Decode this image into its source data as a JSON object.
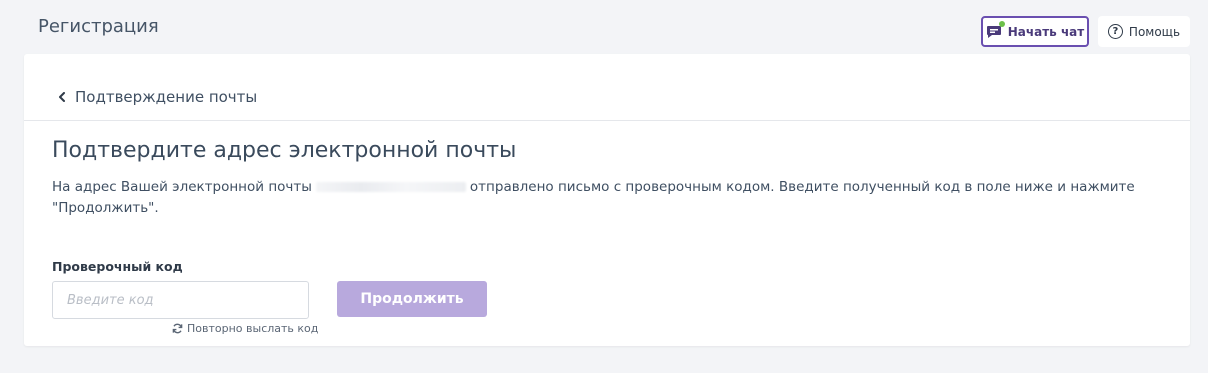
{
  "header": {
    "title": "Регистрация",
    "chat_button_label": "Начать чат",
    "help_button_label": "Помощь"
  },
  "card": {
    "back_link_label": "Подтверждение почты",
    "heading": "Подтвердите адрес электронной почты",
    "description_before": "На адрес Вашей электронной почты",
    "description_after": "отправлено письмо с проверочным кодом. Введите полученный код в поле ниже и нажмите \"Продолжить\".",
    "code_label": "Проверочный код",
    "code_placeholder": "Введите код",
    "code_value": "",
    "continue_button_label": "Продолжить",
    "resend_link_label": "Повторно выслать код"
  },
  "colors": {
    "background": "#f3f4f7",
    "accent": "#6a4fb0",
    "accent_disabled": "#b8a9dd",
    "online_dot": "#6cc04a"
  },
  "icons": {
    "chat": "chat-bubble-icon",
    "help": "question-circle-icon",
    "back": "chevron-left-icon",
    "resend": "refresh-icon"
  }
}
